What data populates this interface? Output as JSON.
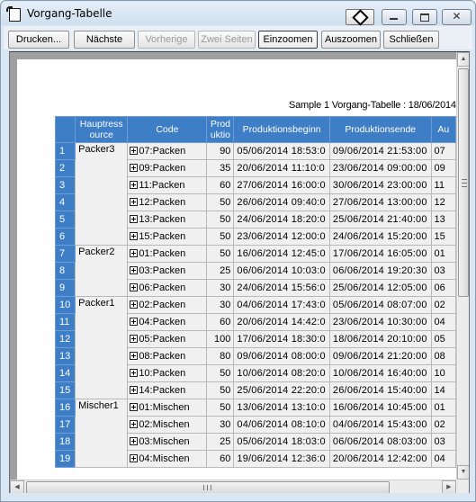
{
  "window": {
    "title": "Vorgang-Tabelle",
    "close_glyph": "✕",
    "icons": [
      "app-document-icon",
      "special-diamond-icon",
      "minimize-icon",
      "maximize-icon",
      "close-icon"
    ]
  },
  "toolbar": {
    "print": "Drucken...",
    "next": "Nächste",
    "previous": "Vorherige",
    "two_pages": "Zwei Seiten",
    "zoom_in": "Einzoomen",
    "zoom_out": "Auszoomen",
    "close": "Schließen"
  },
  "report": {
    "caption": "Sample 1 Vorgang-Tabelle : 18/06/2014"
  },
  "table": {
    "headers": {
      "resource_line1": "Hauptress",
      "resource_line2": "ource",
      "code": "Code",
      "prod_line1": "Prod",
      "prod_line2": "uktio",
      "start": "Produktionsbeginn",
      "end": "Produktionsende",
      "au": "Au"
    },
    "groups": [
      {
        "resource": "Packer3",
        "rows": [
          {
            "n": "1",
            "code": "07:Packen",
            "prod": "90",
            "start": "05/06/2014 18:53:0",
            "end": "09/06/2014 21:53:00",
            "au": "07"
          },
          {
            "n": "2",
            "code": "09:Packen",
            "prod": "35",
            "start": "20/06/2014 11:10:0",
            "end": "23/06/2014 09:00:00",
            "au": "09"
          },
          {
            "n": "3",
            "code": "11:Packen",
            "prod": "60",
            "start": "27/06/2014 16:00:0",
            "end": "30/06/2014 23:00:00",
            "au": "11"
          },
          {
            "n": "4",
            "code": "12:Packen",
            "prod": "50",
            "start": "26/06/2014 09:40:0",
            "end": "27/06/2014 13:00:00",
            "au": "12"
          },
          {
            "n": "5",
            "code": "13:Packen",
            "prod": "50",
            "start": "24/06/2014 18:20:0",
            "end": "25/06/2014 21:40:00",
            "au": "13"
          },
          {
            "n": "6",
            "code": "15:Packen",
            "prod": "50",
            "start": "23/06/2014 12:00:0",
            "end": "24/06/2014 15:20:00",
            "au": "15"
          }
        ]
      },
      {
        "resource": "Packer2",
        "rows": [
          {
            "n": "7",
            "code": "01:Packen",
            "prod": "50",
            "start": "16/06/2014 12:45:0",
            "end": "17/06/2014 16:05:00",
            "au": "01"
          },
          {
            "n": "8",
            "code": "03:Packen",
            "prod": "25",
            "start": "06/06/2014 10:03:0",
            "end": "06/06/2014 19:20:30",
            "au": "03"
          },
          {
            "n": "9",
            "code": "06:Packen",
            "prod": "30",
            "start": "24/06/2014 15:56:0",
            "end": "25/06/2014 12:05:00",
            "au": "06"
          }
        ]
      },
      {
        "resource": "Packer1",
        "rows": [
          {
            "n": "10",
            "code": "02:Packen",
            "prod": "30",
            "start": "04/06/2014 17:43:0",
            "end": "05/06/2014 08:07:00",
            "au": "02"
          },
          {
            "n": "11",
            "code": "04:Packen",
            "prod": "60",
            "start": "20/06/2014 14:42:0",
            "end": "23/06/2014 10:30:00",
            "au": "04"
          },
          {
            "n": "12",
            "code": "05:Packen",
            "prod": "100",
            "start": "17/06/2014 18:30:0",
            "end": "18/06/2014 20:10:00",
            "au": "05"
          },
          {
            "n": "13",
            "code": "08:Packen",
            "prod": "80",
            "start": "09/06/2014 08:00:0",
            "end": "09/06/2014 21:20:00",
            "au": "08"
          },
          {
            "n": "14",
            "code": "10:Packen",
            "prod": "50",
            "start": "10/06/2014 08:20:0",
            "end": "10/06/2014 16:40:00",
            "au": "10"
          },
          {
            "n": "15",
            "code": "14:Packen",
            "prod": "50",
            "start": "25/06/2014 22:20:0",
            "end": "26/06/2014 15:40:00",
            "au": "14"
          }
        ]
      },
      {
        "resource": "Mischer1",
        "rows": [
          {
            "n": "16",
            "code": "01:Mischen",
            "prod": "50",
            "start": "13/06/2014 13:10:0",
            "end": "16/06/2014 10:45:00",
            "au": "01"
          },
          {
            "n": "17",
            "code": "02:Mischen",
            "prod": "30",
            "start": "04/06/2014 08:10:0",
            "end": "04/06/2014 15:43:00",
            "au": "02"
          },
          {
            "n": "18",
            "code": "03:Mischen",
            "prod": "25",
            "start": "05/06/2014 18:03:0",
            "end": "06/06/2014 08:03:00",
            "au": "03"
          },
          {
            "n": "19",
            "code": "04:Mischen",
            "prod": "60",
            "start": "19/06/2014 12:36:0",
            "end": "20/06/2014 12:42:00",
            "au": "04"
          }
        ]
      }
    ]
  },
  "scrollbars": {
    "up": "▲",
    "down": "▼",
    "left": "◀",
    "right": "▶"
  }
}
